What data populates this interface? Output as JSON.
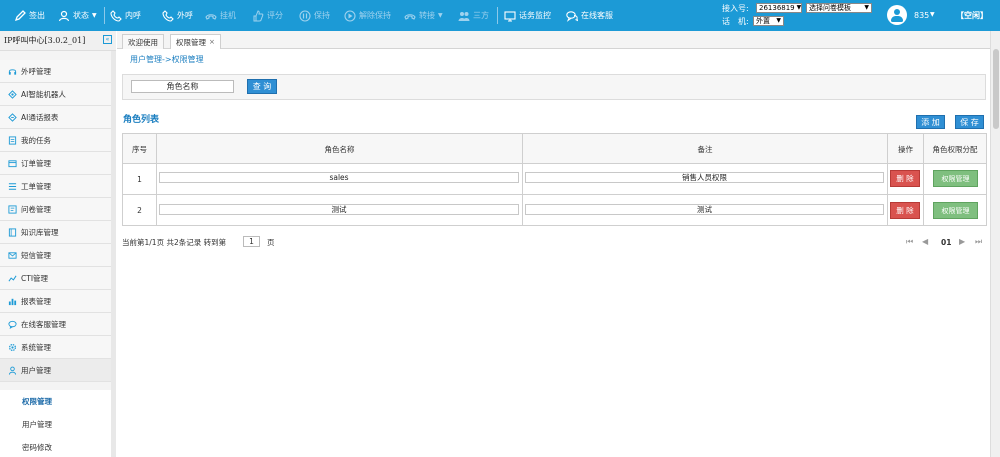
{
  "colors": {
    "topbar": "#1c9ad6",
    "primary_button": "#2f8fd4",
    "delete_button": "#d9534f",
    "permission_button": "#7fbf7f",
    "link": "#1c7fc0"
  },
  "toolbar": {
    "items": [
      {
        "label": "签出",
        "icon": "pen-icon",
        "enabled": true
      },
      {
        "label": "状态",
        "icon": "user-icon",
        "enabled": true
      },
      {
        "label": "内呼",
        "icon": "phone-inbound-icon",
        "enabled": true
      },
      {
        "label": "外呼",
        "icon": "phone-outbound-icon",
        "enabled": true
      },
      {
        "label": "挂机",
        "icon": "hangup-icon",
        "enabled": false
      },
      {
        "label": "评分",
        "icon": "thumbs-up-icon",
        "enabled": false
      },
      {
        "label": "保持",
        "icon": "hold-icon",
        "enabled": false
      },
      {
        "label": "解除保持",
        "icon": "play-icon",
        "enabled": false
      },
      {
        "label": "转接",
        "icon": "transfer-icon",
        "enabled": false
      },
      {
        "label": "三方",
        "icon": "conference-icon",
        "enabled": false
      },
      {
        "label": "话务监控",
        "icon": "monitor-icon",
        "enabled": true
      },
      {
        "label": "在线客服",
        "icon": "chat-icon",
        "enabled": true
      }
    ],
    "access_number_label": "接入号:",
    "access_number_value": "26136819",
    "survey_select": "选择问卷模板",
    "phone_label": "话　机:",
    "phone_value": "外置",
    "agent_number": "835",
    "agent_status": "【空闲】"
  },
  "sidebar": {
    "title": "IP呼叫中心[3.0.2_01]",
    "collapse_icon": "«",
    "items": [
      {
        "label": "外呼管理",
        "icon": "headset-icon"
      },
      {
        "label": "AI智能机器人",
        "icon": "robot-icon"
      },
      {
        "label": "AI通话报表",
        "icon": "report-icon"
      },
      {
        "label": "我的任务",
        "icon": "task-icon"
      },
      {
        "label": "订单管理",
        "icon": "order-icon"
      },
      {
        "label": "工单管理",
        "icon": "list-icon"
      },
      {
        "label": "问卷管理",
        "icon": "survey-icon"
      },
      {
        "label": "知识库管理",
        "icon": "knowledge-icon"
      },
      {
        "label": "短信管理",
        "icon": "mail-icon"
      },
      {
        "label": "CTI管理",
        "icon": "chart-line-icon"
      },
      {
        "label": "报表管理",
        "icon": "bar-chart-icon"
      },
      {
        "label": "在线客服管理",
        "icon": "chat-icon"
      },
      {
        "label": "系统管理",
        "icon": "gear-icon"
      },
      {
        "label": "用户管理",
        "icon": "user-icon"
      }
    ],
    "subitems": [
      {
        "label": "权限管理",
        "active": true
      },
      {
        "label": "用户管理",
        "active": false
      },
      {
        "label": "密码修改",
        "active": false
      }
    ]
  },
  "tabs": [
    {
      "label": "欢迎使用",
      "active": false,
      "closable": false
    },
    {
      "label": "权限管理",
      "active": true,
      "closable": true,
      "close": "×"
    }
  ],
  "breadcrumb": "用户管理->权限管理",
  "search": {
    "value": "角色名称",
    "button": "查 询"
  },
  "list": {
    "title": "角色列表",
    "add_button": "添 加",
    "save_button": "保 存",
    "columns": [
      "序号",
      "角色名称",
      "备注",
      "操作",
      "角色权限分配"
    ],
    "rows": [
      {
        "index": "1",
        "name": "sales",
        "remark": "销售人员权限",
        "delete": "删 除",
        "permission": "权限管理"
      },
      {
        "index": "2",
        "name": "测试",
        "remark": "测试",
        "delete": "删 除",
        "permission": "权限管理"
      }
    ]
  },
  "pager": {
    "summary": "当前第1/1页 共2条记录 转到第",
    "page_input": "1",
    "suffix": "页",
    "current": "01",
    "first": "⏮",
    "prev": "◀",
    "next": "▶",
    "last": "⏭"
  }
}
